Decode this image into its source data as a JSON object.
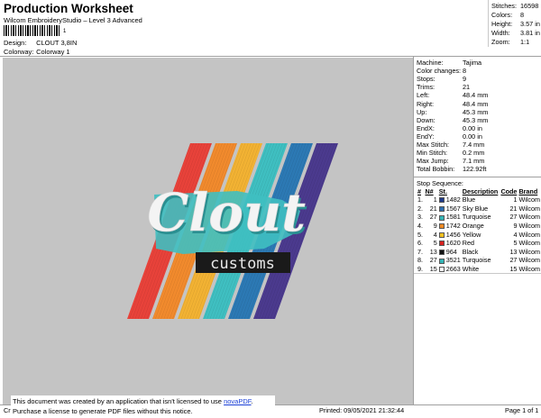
{
  "header": {
    "title": "Production Worksheet",
    "subtitle": "Wilcom EmbroideryStudio – Level 3 Advanced",
    "barcode_suffix": "1",
    "design_label": "Design:",
    "design_value": "CLOUT 3,8IN",
    "colorway_label": "Colorway:",
    "colorway_value": "Colorway 1"
  },
  "stats": [
    {
      "label": "Stitches:",
      "value": "16598"
    },
    {
      "label": "Colors:",
      "value": "8"
    },
    {
      "label": "Height:",
      "value": "3.57 in"
    },
    {
      "label": "Width:",
      "value": "3.81 in"
    },
    {
      "label": "Zoom:",
      "value": "1:1"
    }
  ],
  "design_artwork": {
    "logo_word": "Clout",
    "logo_subword": "customs",
    "stripe_colors": [
      "#e8423a",
      "#f18a2d",
      "#f2b233",
      "#3fbfc1",
      "#2c79b4",
      "#4b3a8e"
    ]
  },
  "machine_info": [
    {
      "label": "Machine:",
      "value": "Tajima"
    },
    {
      "label": "Color changes:",
      "value": "8"
    },
    {
      "label": "Stops:",
      "value": "9"
    },
    {
      "label": "Trims:",
      "value": "21"
    },
    {
      "label": "Left:",
      "value": "48.4 mm"
    },
    {
      "label": "Right:",
      "value": "48.4 mm"
    },
    {
      "label": "Up:",
      "value": "45.3 mm"
    },
    {
      "label": "Down:",
      "value": "45.3 mm"
    },
    {
      "label": "EndX:",
      "value": "0.00 in"
    },
    {
      "label": "EndY:",
      "value": "0.00 in"
    },
    {
      "label": "Max Stitch:",
      "value": "7.4 mm"
    },
    {
      "label": "Min Stitch:",
      "value": "0.2 mm"
    },
    {
      "label": "Max Jump:",
      "value": "7.1 mm"
    },
    {
      "label": "Total Bobbin:",
      "value": "122.92ft"
    }
  ],
  "stop_sequence": {
    "title": "Stop Sequence:",
    "headers": [
      "#",
      "N#",
      "St.",
      "Description",
      "Code",
      "Brand"
    ],
    "rows": [
      {
        "n": "1.",
        "needle": "1",
        "color": "#1f3a8a",
        "st": "1482",
        "desc": "Blue",
        "code": "1",
        "brand": "Wilcom"
      },
      {
        "n": "2.",
        "needle": "21",
        "color": "#2f6fb0",
        "st": "1567",
        "desc": "Sky Blue",
        "code": "21",
        "brand": "Wilcom"
      },
      {
        "n": "3.",
        "needle": "27",
        "color": "#35b5b6",
        "st": "1581",
        "desc": "Turquoise",
        "code": "27",
        "brand": "Wilcom"
      },
      {
        "n": "4.",
        "needle": "9",
        "color": "#f08a24",
        "st": "1742",
        "desc": "Orange",
        "code": "9",
        "brand": "Wilcom"
      },
      {
        "n": "5.",
        "needle": "4",
        "color": "#f4c020",
        "st": "1456",
        "desc": "Yellow",
        "code": "4",
        "brand": "Wilcom"
      },
      {
        "n": "6.",
        "needle": "5",
        "color": "#d8221f",
        "st": "1620",
        "desc": "Red",
        "code": "5",
        "brand": "Wilcom"
      },
      {
        "n": "7.",
        "needle": "13",
        "color": "#111111",
        "st": "964",
        "desc": "Black",
        "code": "13",
        "brand": "Wilcom"
      },
      {
        "n": "8.",
        "needle": "27",
        "color": "#35b5b6",
        "st": "3521",
        "desc": "Turquoise",
        "code": "27",
        "brand": "Wilcom"
      },
      {
        "n": "9.",
        "needle": "15",
        "color": "#ffffff",
        "st": "2663",
        "desc": "White",
        "code": "15",
        "brand": "Wilcom"
      }
    ]
  },
  "footer": {
    "left": "Cr",
    "printed": "Printed: 09/05/2021 21:32:44",
    "page": "Page 1 of 1",
    "notice_line1_pre": "This document was created by an application that isn't licensed to use ",
    "notice_link": "novaPDF",
    "notice_line1_post": ".",
    "notice_line2": "Purchase a license to generate PDF files without this notice."
  }
}
